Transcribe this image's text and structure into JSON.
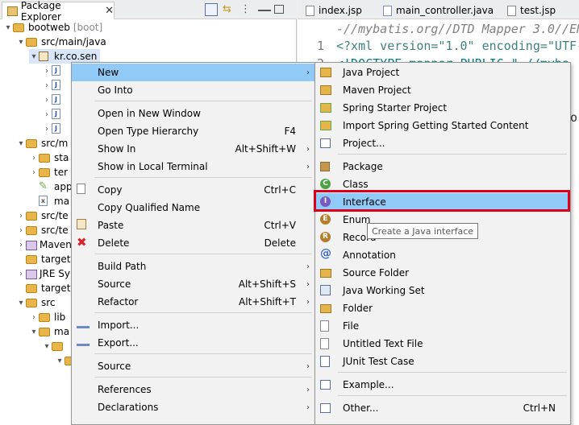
{
  "explorer": {
    "tab_label": "Package Explorer",
    "close_glyph": "✕",
    "project": "bootweb",
    "project_tag": "[boot]",
    "tree": [
      "src/main/java",
      "kr.co.sen",
      "src/m",
      "sta",
      "ter",
      "app",
      "ma",
      "src/te",
      "src/te",
      "Maven",
      "target",
      "JRE Sy",
      "target",
      "src",
      "lib",
      "ma"
    ]
  },
  "editor": {
    "tabs": [
      "index.jsp",
      "main_controller.java",
      "test.jsp"
    ],
    "line0": "-//mybatis.org//DTD Mapper 3.0//EN\"",
    "line1_num": "1",
    "line1": "<?xml version=\"1.0\" encoding=\"UTF-8\"?>",
    "line2_num": "2",
    "line2": "<!DOCTYPE mapper PUBLIC \"-//myba",
    "side_text": "o"
  },
  "context_menu": {
    "items": [
      {
        "label": "New",
        "accel": "",
        "submenu": true,
        "icon": ""
      },
      {
        "label": "Go Into",
        "accel": "",
        "submenu": false,
        "icon": ""
      },
      {
        "label": "Open in New Window",
        "accel": "",
        "submenu": false,
        "icon": ""
      },
      {
        "label": "Open Type Hierarchy",
        "accel": "F4",
        "submenu": false,
        "icon": ""
      },
      {
        "label": "Show In",
        "accel": "Alt+Shift+W",
        "submenu": true,
        "icon": ""
      },
      {
        "label": "Show in Local Terminal",
        "accel": "",
        "submenu": true,
        "icon": ""
      },
      {
        "label": "Copy",
        "accel": "Ctrl+C",
        "submenu": false,
        "icon": "copy-icon"
      },
      {
        "label": "Copy Qualified Name",
        "accel": "",
        "submenu": false,
        "icon": ""
      },
      {
        "label": "Paste",
        "accel": "Ctrl+V",
        "submenu": false,
        "icon": "paste-icon"
      },
      {
        "label": "Delete",
        "accel": "Delete",
        "submenu": false,
        "icon": "delete-icon"
      },
      {
        "label": "Build Path",
        "accel": "",
        "submenu": true,
        "icon": ""
      },
      {
        "label": "Source",
        "accel": "Alt+Shift+S",
        "submenu": true,
        "icon": ""
      },
      {
        "label": "Refactor",
        "accel": "Alt+Shift+T",
        "submenu": true,
        "icon": ""
      },
      {
        "label": "Import...",
        "accel": "",
        "submenu": false,
        "icon": "import-icon"
      },
      {
        "label": "Export...",
        "accel": "",
        "submenu": false,
        "icon": "export-icon"
      },
      {
        "label": "Source",
        "accel": "",
        "submenu": true,
        "icon": ""
      },
      {
        "label": "References",
        "accel": "",
        "submenu": true,
        "icon": ""
      },
      {
        "label": "Declarations",
        "accel": "",
        "submenu": true,
        "icon": ""
      }
    ]
  },
  "new_submenu": {
    "items": [
      {
        "label": "Java Project",
        "accel": "",
        "icon": "java-project-icon"
      },
      {
        "label": "Maven Project",
        "accel": "",
        "icon": "maven-project-icon"
      },
      {
        "label": "Spring Starter Project",
        "accel": "",
        "icon": "spring-starter-icon"
      },
      {
        "label": "Import Spring Getting Started Content",
        "accel": "",
        "icon": "spring-import-icon"
      },
      {
        "label": "Project...",
        "accel": "",
        "icon": "project-icon"
      },
      {
        "label": "Package",
        "accel": "",
        "icon": "package-icon"
      },
      {
        "label": "Class",
        "accel": "",
        "icon": "class-icon"
      },
      {
        "label": "Interface",
        "accel": "",
        "icon": "interface-icon"
      },
      {
        "label": "Enum",
        "accel": "",
        "icon": "enum-icon"
      },
      {
        "label": "Record",
        "accel": "",
        "icon": "record-icon"
      },
      {
        "label": "Annotation",
        "accel": "",
        "icon": "annotation-icon"
      },
      {
        "label": "Source Folder",
        "accel": "",
        "icon": "source-folder-icon"
      },
      {
        "label": "Java Working Set",
        "accel": "",
        "icon": "working-set-icon"
      },
      {
        "label": "Folder",
        "accel": "",
        "icon": "folder-icon"
      },
      {
        "label": "File",
        "accel": "",
        "icon": "file-icon"
      },
      {
        "label": "Untitled Text File",
        "accel": "",
        "icon": "text-file-icon"
      },
      {
        "label": "JUnit Test Case",
        "accel": "",
        "icon": "junit-icon"
      },
      {
        "label": "Example...",
        "accel": "",
        "icon": "example-icon"
      },
      {
        "label": "Other...",
        "accel": "Ctrl+N",
        "icon": "other-icon"
      }
    ]
  },
  "tooltip": "Create a Java interface",
  "colors": {
    "menu_highlight": "#91c9f7",
    "annotation_box": "#d9001b",
    "code_keyword": "#7f0055",
    "code_string": "#2a00ff",
    "code_comment": "#3f7f5f"
  }
}
